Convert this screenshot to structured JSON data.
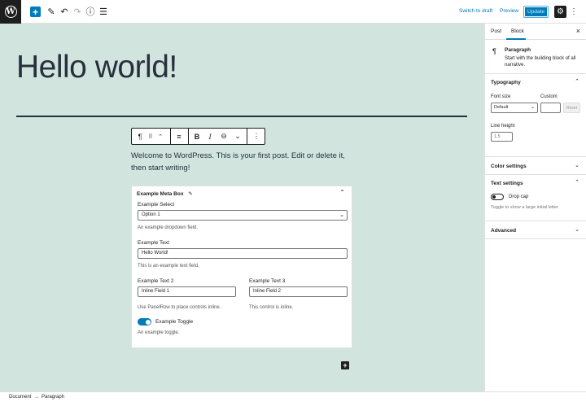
{
  "topbar": {
    "logo_icon": "wordpress-logo-icon",
    "logo_glyph": "W",
    "add_glyph": "+",
    "tools": [
      {
        "name": "edit-icon",
        "glyph": "✎"
      },
      {
        "name": "undo-icon",
        "glyph": "↶"
      },
      {
        "name": "redo-icon",
        "glyph": "↷"
      },
      {
        "name": "info-icon",
        "glyph": "ⓘ"
      },
      {
        "name": "list-view-icon",
        "glyph": "☰"
      }
    ],
    "switch_to_draft": "Switch to draft",
    "preview": "Preview",
    "update": "Update",
    "settings_glyph": "⚙",
    "more_glyph": "⋮"
  },
  "editor": {
    "title": "Hello world!",
    "paragraph": "Welcome to WordPress. This is your first post. Edit or delete it, then start writing!",
    "block_toolbar": {
      "paragraph_glyph": "¶",
      "drag_glyph": "⠿",
      "move_glyph": "⌃",
      "align_glyph": "≡",
      "bold": "B",
      "italic": "I",
      "link_glyph": "⊖",
      "more_rich_glyph": "⌄",
      "options_glyph": "⋮"
    },
    "inserter_glyph": "+"
  },
  "metabox": {
    "title": "Example Meta Box",
    "title_icon": "megaphone-icon",
    "title_icon_glyph": "✎",
    "collapse_glyph": "⌃",
    "select_label": "Example Select",
    "select_value": "Option 1",
    "select_help": "An example dropdown field.",
    "text_label": "Example Text",
    "text_value": "Hello World!",
    "text_help": "This is an example text field.",
    "text2_label": "Example Text 2",
    "text2_value": "Inline Field 1",
    "text2_help": "Use PanelRow to place controls inline.",
    "text3_label": "Example Text 3",
    "text3_value": "Inline Field 2",
    "text3_help": "This control is inline.",
    "toggle_label": "Example Toggle",
    "toggle_checked": true,
    "toggle_help": "An example toggle."
  },
  "sidebar": {
    "tabs": {
      "post": "Post",
      "block": "Block",
      "active": "Block"
    },
    "close_glyph": "×",
    "block": {
      "icon_glyph": "¶",
      "name": "Paragraph",
      "description": "Start with the building block of all narrative."
    },
    "typography": {
      "title": "Typography",
      "font_size_label": "Font size",
      "font_size_value": "Default",
      "custom_label": "Custom",
      "reset": "Reset",
      "line_height_label": "Line height",
      "line_height_placeholder": "1.5"
    },
    "color_settings": "Color settings",
    "text_settings": {
      "title": "Text settings",
      "drop_cap_label": "Drop cap",
      "drop_cap_checked": false,
      "drop_cap_help": "Toggle to show a large initial letter."
    },
    "advanced": "Advanced",
    "chevron_up": "⌃",
    "chevron_down": "⌄"
  },
  "footer": {
    "breadcrumb": [
      "Document",
      "Paragraph"
    ],
    "separator": "→"
  },
  "colors": {
    "accent": "#007cba",
    "canvas_bg": "#d1e4dd",
    "text": "#28303d"
  }
}
